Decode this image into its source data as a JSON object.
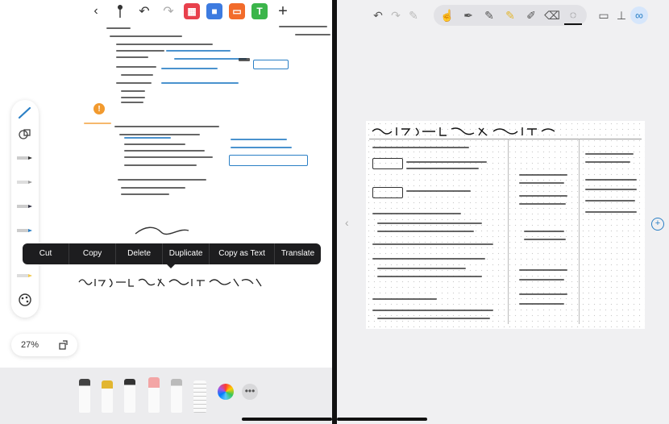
{
  "left_toolbar": {
    "app_icons": [
      {
        "icon": "grid-icon",
        "color": "#e8404c"
      },
      {
        "icon": "square-icon",
        "color": "#3d7be0"
      },
      {
        "icon": "image-icon",
        "color": "#f26b2a"
      },
      {
        "icon": "text-icon",
        "color": "#3bb54a",
        "label": "T"
      }
    ]
  },
  "context_menu": {
    "items": [
      "Cut",
      "Copy",
      "Delete",
      "Duplicate",
      "Copy as Text",
      "Translate"
    ]
  },
  "zoom": {
    "level": "27%"
  },
  "colors": {
    "ink": "#333333",
    "accent_blue": "#2a7fc5",
    "badge_orange": "#f29a2e"
  }
}
